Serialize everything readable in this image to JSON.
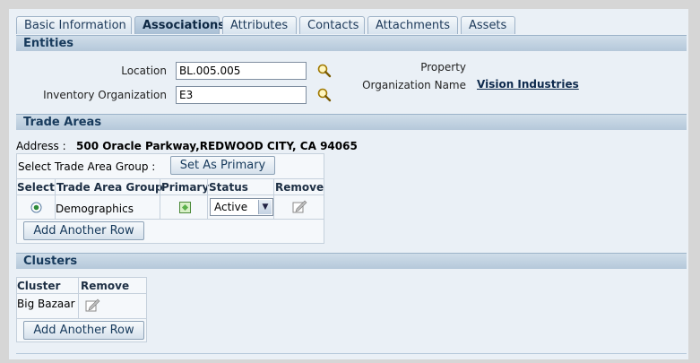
{
  "tabs": [
    "Basic Information",
    "Associations",
    "Attributes",
    "Contacts",
    "Attachments",
    "Assets"
  ],
  "active_tab": "Associations",
  "entities": {
    "header": "Entities",
    "location_label": "Location",
    "location_value": "BL.005.005",
    "inv_org_label": "Inventory Organization",
    "inv_org_value": "E3",
    "property_label": "Property",
    "org_name_label": "Organization Name",
    "org_name_value": "Vision Industries"
  },
  "trade_areas": {
    "header": "Trade Areas",
    "address_label": "Address :",
    "address_value": "500 Oracle Parkway,REDWOOD CITY, CA 94065",
    "group_label": "Select Trade Area Group :",
    "set_primary_button": "Set As Primary",
    "columns": [
      "Select",
      "Trade Area Group",
      "Primary",
      "Status",
      "Remove"
    ],
    "rows": [
      {
        "group": "Demographics",
        "status": "Active",
        "selected": true
      }
    ],
    "add_row_button": "Add Another Row"
  },
  "clusters": {
    "header": "Clusters",
    "columns": [
      "Cluster",
      "Remove"
    ],
    "rows": [
      {
        "cluster": "Big Bazaar"
      }
    ],
    "add_row_button": "Add Another Row"
  },
  "colors": {
    "accent": "#173a5c",
    "section_bg": "#b5c8da",
    "panel_bg": "#eaf0f6"
  },
  "icons": [
    "search-icon",
    "radio-selected-icon",
    "primary-flag-icon",
    "remove-icon",
    "chevron-down-icon"
  ]
}
